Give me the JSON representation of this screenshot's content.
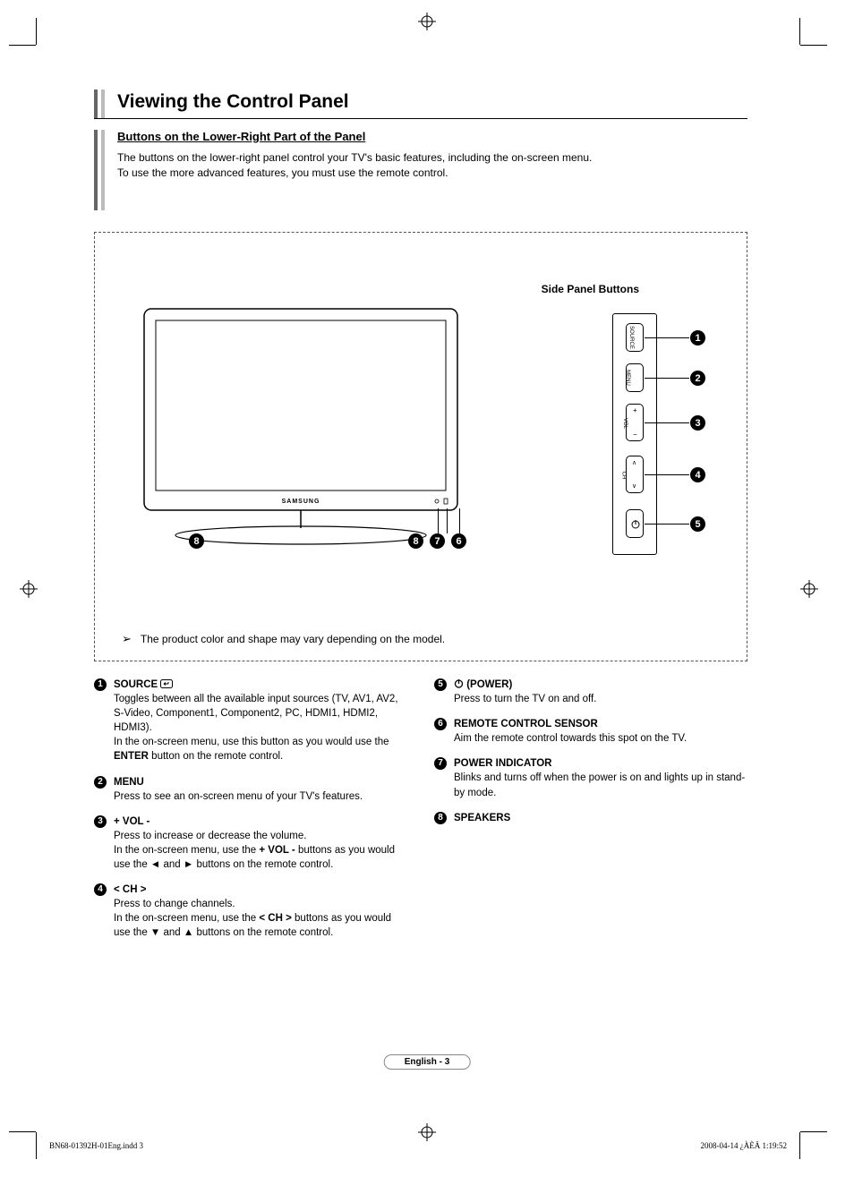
{
  "title": "Viewing the Control Panel",
  "subtitle": "Buttons on the Lower-Right Part of the Panel",
  "intro_line1": "The buttons on the lower-right panel control your TV's basic features, including the on-screen menu.",
  "intro_line2": "To use the more advanced features, you must use the remote control.",
  "side_panel_label": "Side Panel Buttons",
  "tv_brand": "SAMSUNG",
  "panel_buttons": {
    "b1": "SOURCE",
    "b2": "MENU",
    "b3": "VOL",
    "b4": "CH",
    "b5": ""
  },
  "note": "The product color and shape may vary depending on the model.",
  "left_items": [
    {
      "n": "1",
      "head": "SOURCE ",
      "body_html": "Toggles between all the available input sources (TV, AV1, AV2, S-Video, Component1, Component2, PC, HDMI1, HDMI2, HDMI3).<br>In the on-screen menu, use this button as you would use the <b>ENTER</b> button on the remote control."
    },
    {
      "n": "2",
      "head": "MENU",
      "body_html": "Press to see an on-screen menu of your TV's features."
    },
    {
      "n": "3",
      "head": "+ VOL -",
      "body_html": "Press to increase or decrease the volume.<br>In the on-screen menu, use the <b>+ VOL -</b> buttons as you would use the <span class='arrow'>◄</span> and <span class='arrow'>►</span> buttons on the remote control."
    },
    {
      "n": "4",
      "head": "< CH >",
      "body_html": "Press to change channels.<br>In the on-screen menu, use the <b>&lt; CH &gt;</b> buttons as you would use the <span class='arrow'>▼</span> and <span class='arrow'>▲</span> buttons on the remote control."
    }
  ],
  "right_items": [
    {
      "n": "5",
      "head": " (POWER)",
      "icon": "power",
      "body_html": "Press to turn the TV on and off."
    },
    {
      "n": "6",
      "head": "REMOTE CONTROL SENSOR",
      "body_html": "Aim the remote control towards this spot on the TV."
    },
    {
      "n": "7",
      "head": "POWER INDICATOR",
      "body_html": "Blinks and turns off when the power is on and lights up in stand-by mode."
    },
    {
      "n": "8",
      "head": "SPEAKERS",
      "body_html": ""
    }
  ],
  "page_footer": "English - 3",
  "doc_footer_left": "BN68-01392H-01Eng.indd   3",
  "doc_footer_right": "2008-04-14   ¿ÀÈÄ 1:19:52"
}
